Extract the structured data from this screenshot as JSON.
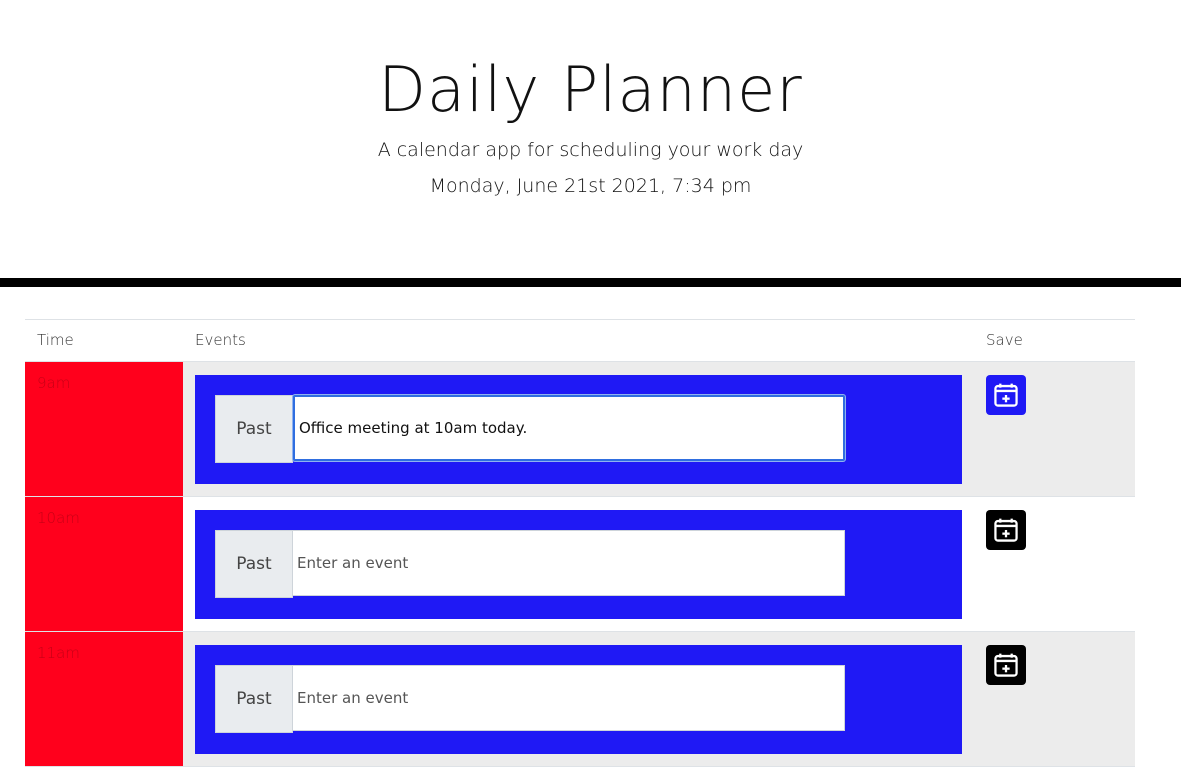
{
  "header": {
    "title": "Daily Planner",
    "subtitle": "A calendar app for scheduling your work day",
    "date": "Monday, June 21st 2021, 7:34 pm"
  },
  "table": {
    "headers": {
      "time": "Time",
      "events": "Events",
      "save": "Save"
    },
    "rows": [
      {
        "time": "9am",
        "status": "Past",
        "value": "Office meeting at 10am today.",
        "placeholder": "Enter an event",
        "save_color": "#1f19f5"
      },
      {
        "time": "10am",
        "status": "Past",
        "value": "",
        "placeholder": "Enter an event",
        "save_color": "#000000"
      },
      {
        "time": "11am",
        "status": "Past",
        "value": "",
        "placeholder": "Enter an event",
        "save_color": "#000000"
      }
    ]
  },
  "icons": {
    "save": "calendar-plus-icon"
  },
  "colors": {
    "past_time": "#ff001c",
    "event_panel": "#1f19f5",
    "divider": "#000000"
  }
}
